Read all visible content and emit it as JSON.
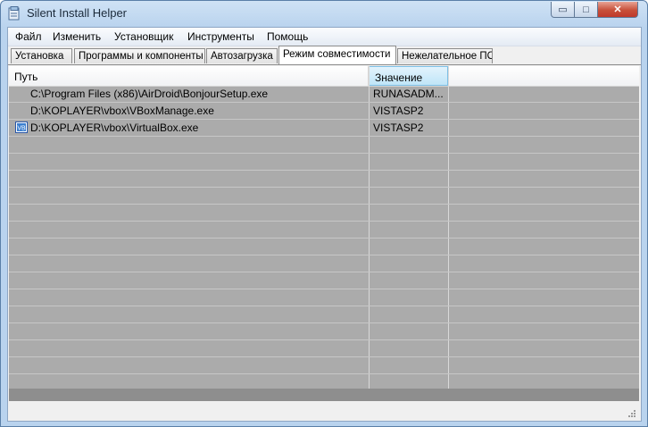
{
  "window": {
    "title": "Silent Install Helper",
    "icon": "app-window-icon"
  },
  "controls": {
    "minimize": "▭",
    "maximize": "□",
    "close": "✕"
  },
  "menu": [
    "Файл",
    "Изменить",
    "Установщик",
    "Инструменты",
    "Помощь"
  ],
  "tabs": [
    "Установка",
    "Программы и компоненты",
    "Автозагрузка",
    "Режим совместимости",
    "Нежелательное ПО"
  ],
  "active_tab": "Режим совместимости",
  "table": {
    "columns": [
      "Путь",
      "Значение"
    ],
    "rows": [
      {
        "path": "C:\\Program Files (x86)\\AirDroid\\BonjourSetup.exe",
        "value": "RUNASADM...",
        "icon": ""
      },
      {
        "path": "D:\\KOPLAYER\\vbox\\VBoxManage.exe",
        "value": "VISTASP2",
        "icon": ""
      },
      {
        "path": "D:\\KOPLAYER\\vbox\\VirtualBox.exe",
        "value": "VISTASP2",
        "icon": "virtualbox-icon"
      }
    ]
  },
  "colors": {
    "grid_bg": "#ababab",
    "title_bg": "#b9d3ee",
    "close": "#c0392b"
  }
}
